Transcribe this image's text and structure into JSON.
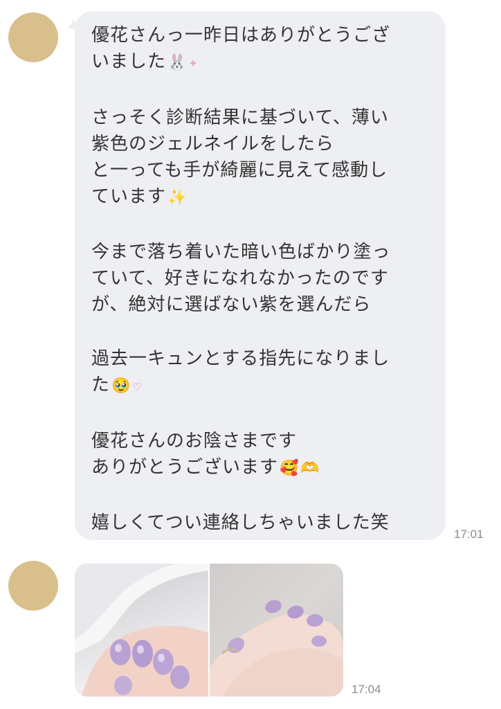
{
  "messages": [
    {
      "paragraphs": [
        {
          "lines": [
            "優花さんっ一昨日はありがとうござ",
            "いました"
          ],
          "trailing": [
            {
              "icon": "bunny-emoji",
              "glyph": "🐰"
            },
            {
              "icon": "sparkle-pink",
              "glyph": "✦"
            }
          ]
        },
        {
          "lines": [
            "さっそく診断結果に基づいて、薄い",
            "紫色のジェルネイルをしたら",
            "と一っても手が綺麗に見えて感動し",
            "ています"
          ],
          "trailing": [
            {
              "icon": "sparkles-emoji",
              "glyph": "✨"
            }
          ]
        },
        {
          "lines": [
            "今まで落ち着いた暗い色ばかり塗っ",
            "ていて、好きになれなかったのです",
            "が、絶対に選ばない紫を選んだら"
          ],
          "trailing": []
        },
        {
          "lines": [
            "過去一キュンとする指先になりまし",
            "た"
          ],
          "trailing": [
            {
              "icon": "pleading-face-emoji",
              "glyph": "🥹"
            },
            {
              "icon": "heart-doodle",
              "glyph": "♡"
            }
          ]
        },
        {
          "lines": [
            "優花さんのお陰さまです",
            "ありがとうございます"
          ],
          "trailing": [
            {
              "icon": "smiling-hearts-emoji",
              "glyph": "🥰"
            },
            {
              "icon": "heart-hands-emoji",
              "glyph": "🫶"
            }
          ]
        },
        {
          "lines": [
            "嬉しくてつい連絡しちゃいました笑"
          ],
          "trailing": []
        }
      ],
      "time": "17:01"
    },
    {
      "type": "photos",
      "photo_count": 2,
      "time": "17:04"
    }
  ],
  "colors": {
    "avatar": "#d9bf8c",
    "bubble": "#eeeff2",
    "text": "#333333",
    "time": "#8b8b8b"
  }
}
